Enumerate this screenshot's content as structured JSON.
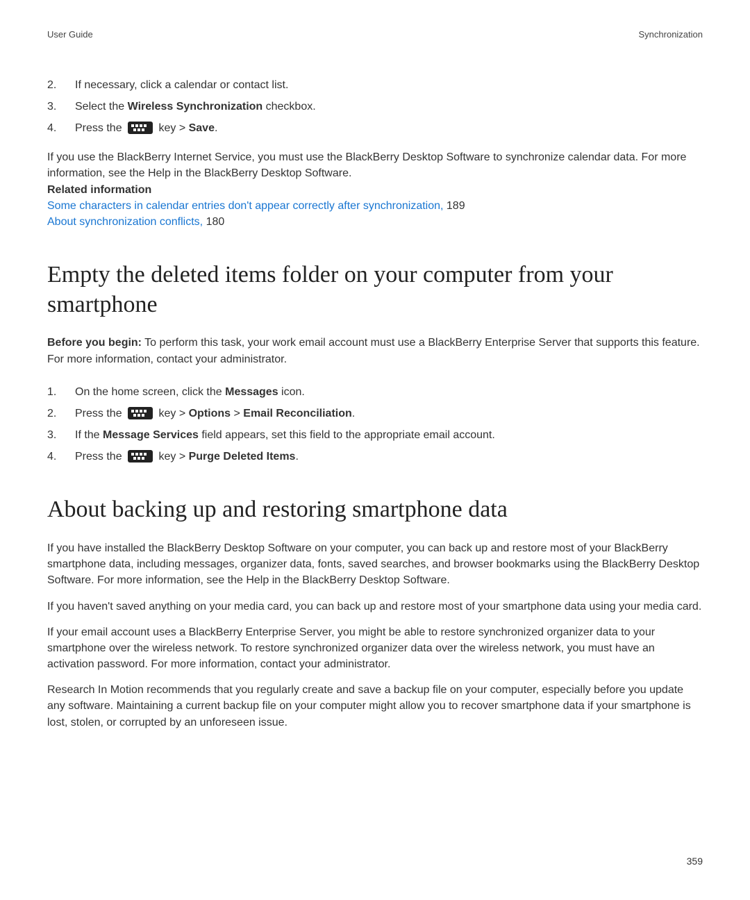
{
  "header": {
    "left": "User Guide",
    "right": "Synchronization"
  },
  "steps1": {
    "n2": "2.",
    "t2": "If necessary, click a calendar or contact list.",
    "n3": "3.",
    "t3a": "Select the ",
    "t3b": "Wireless Synchronization",
    "t3c": " checkbox.",
    "n4": "4.",
    "t4a": "Press the ",
    "t4b": " key > ",
    "t4c": "Save",
    "t4d": "."
  },
  "para1a": "If you use the BlackBerry Internet Service, you must use the BlackBerry Desktop Software to synchronize calendar data. For more information, see the Help in the BlackBerry Desktop Software.",
  "related": {
    "heading": "Related information",
    "link1": "Some characters in calendar entries don't appear correctly after synchronization,",
    "page1": " 189",
    "link2": "About synchronization conflicts,",
    "page2": " 180"
  },
  "section1": {
    "title": "Empty the deleted items folder on your computer from your smartphone",
    "before_label": "Before you begin:",
    "before_text": " To perform this task, your work email account must use a BlackBerry Enterprise Server that supports this feature. For more information, contact your administrator."
  },
  "steps2": {
    "n1": "1.",
    "t1a": "On the home screen, click the ",
    "t1b": "Messages",
    "t1c": " icon.",
    "n2": "2.",
    "t2a": "Press the ",
    "t2b": " key > ",
    "t2c": "Options",
    "t2d": " > ",
    "t2e": "Email Reconciliation",
    "t2f": ".",
    "n3": "3.",
    "t3a": "If the ",
    "t3b": "Message Services",
    "t3c": " field appears, set this field to the appropriate email account.",
    "n4": "4.",
    "t4a": "Press the ",
    "t4b": " key > ",
    "t4c": "Purge Deleted Items",
    "t4d": "."
  },
  "section2": {
    "title": "About backing up and restoring smartphone data",
    "p1": "If you have installed the BlackBerry Desktop Software on your computer, you can back up and restore most of your BlackBerry smartphone data, including messages, organizer data, fonts, saved searches, and browser bookmarks using the BlackBerry Desktop Software. For more information, see the Help in the BlackBerry Desktop Software.",
    "p2": "If you haven't saved anything on your media card, you can back up and restore most of your smartphone data using your media card.",
    "p3": "If your email account uses a BlackBerry Enterprise Server, you might be able to restore synchronized organizer data to your smartphone over the wireless network. To restore synchronized organizer data over the wireless network, you must have an activation password. For more information, contact your administrator.",
    "p4": "Research In Motion recommends that you regularly create and save a backup file on your computer, especially before you update any software. Maintaining a current backup file on your computer might allow you to recover smartphone data if your smartphone is lost, stolen, or corrupted by an unforeseen issue."
  },
  "page_number": "359"
}
